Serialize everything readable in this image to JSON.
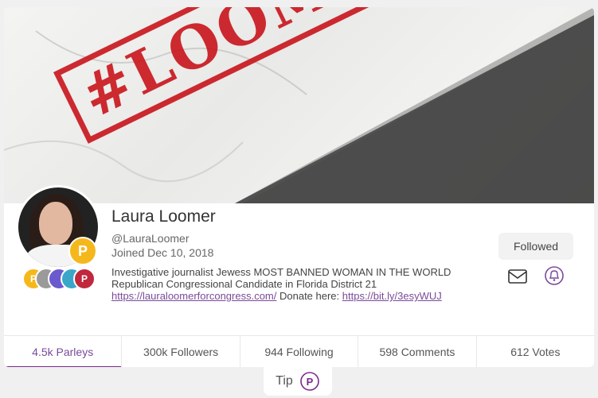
{
  "banner": {
    "stamp_text": "#LOOMERED"
  },
  "profile": {
    "name": "Laura Loomer",
    "handle": "@LauraLoomer",
    "joined": "Joined Dec 10, 2018",
    "bio_text": "Investigative journalist Jewess MOST BANNED WOMAN IN THE WORLD Republican Congressional Candidate in Florida District 21",
    "bio_link1": "https://lauraloomerforcongress.com/",
    "bio_mid": " Donate here: ",
    "bio_link2": "https://bit.ly/3esyWUJ",
    "avatar_badge_glyph": "P",
    "badges": [
      {
        "glyph": "P",
        "color": "#f5b81c"
      },
      {
        "glyph": "",
        "color": "#9a9a9a"
      },
      {
        "glyph": "",
        "color": "#6a5acd"
      },
      {
        "glyph": "",
        "color": "#3aa7c9"
      },
      {
        "glyph": "P",
        "color": "#c0283d"
      }
    ]
  },
  "actions": {
    "follow_label": "Followed"
  },
  "stats": [
    {
      "label": "4.5k Parleys"
    },
    {
      "label": "300k Followers"
    },
    {
      "label": "944 Following"
    },
    {
      "label": "598 Comments"
    },
    {
      "label": "612 Votes"
    }
  ],
  "tip": {
    "label": "Tip"
  },
  "colors": {
    "accent": "#7b2a8a",
    "stamp": "#c8141b",
    "badge_gold": "#f5b81c"
  }
}
